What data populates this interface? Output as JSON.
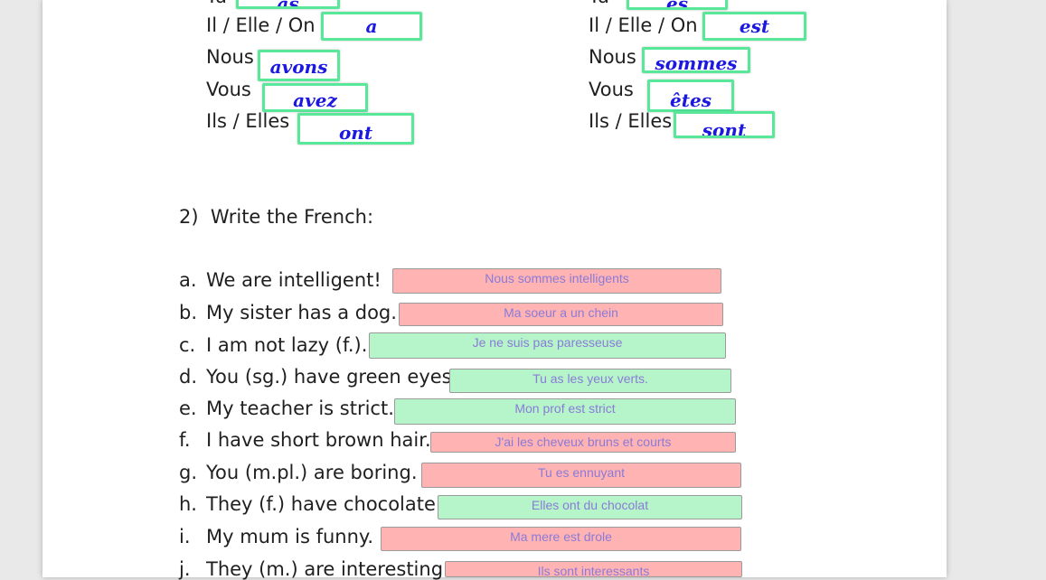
{
  "section1": {
    "left": [
      {
        "pronoun": "Tu",
        "answer": "as"
      },
      {
        "pronoun": "Il / Elle / On",
        "answer": "a"
      },
      {
        "pronoun": "Nous",
        "answer": "avons"
      },
      {
        "pronoun": "Vous",
        "answer": "avez"
      },
      {
        "pronoun": "Ils / Elles",
        "answer": "ont"
      }
    ],
    "right": [
      {
        "pronoun": "Tu",
        "answer": "es"
      },
      {
        "pronoun": "Il / Elle / On",
        "answer": "est"
      },
      {
        "pronoun": "Nous",
        "answer": "sommes"
      },
      {
        "pronoun": "Vous",
        "answer": "êtes"
      },
      {
        "pronoun": "Ils / Elles",
        "answer": "sont"
      }
    ]
  },
  "section2": {
    "heading": "2)  Write the French:",
    "items": [
      {
        "letter": "a.",
        "prompt": "We are intelligent!",
        "answer": "Nous sommes intelligents",
        "status": "wrong"
      },
      {
        "letter": "b.",
        "prompt": "My sister has a dog.",
        "answer": "Ma soeur a un chein",
        "status": "wrong"
      },
      {
        "letter": "c.",
        "prompt": "I am not lazy (f.).",
        "answer": "Je ne suis pas paresseuse",
        "status": "right"
      },
      {
        "letter": "d.",
        "prompt": "You (sg.) have green eyes.",
        "answer": "Tu as les yeux verts.",
        "status": "right"
      },
      {
        "letter": "e.",
        "prompt": "My teacher is strict.",
        "answer": "Mon prof est strict",
        "status": "right"
      },
      {
        "letter": "f.",
        "prompt": "I have short brown hair.",
        "answer": "J'ai les cheveux bruns et courts",
        "status": "wrong"
      },
      {
        "letter": "g.",
        "prompt": "You (m.pl.) are boring.",
        "answer": "Tu es ennuyant",
        "status": "wrong"
      },
      {
        "letter": "h.",
        "prompt": "They (f.) have chocolate.",
        "answer": "Elles ont du chocolat",
        "status": "right"
      },
      {
        "letter": "i.",
        "prompt": "My mum is funny.",
        "answer": "Ma mere est drole",
        "status": "wrong"
      },
      {
        "letter": "j.",
        "prompt": "They (m.) are interesting.",
        "answer": "Ils sont interessants",
        "status": "wrong"
      }
    ]
  },
  "colors": {
    "correct": "#b5f5c9",
    "incorrect": "#ffb3b3",
    "conjugation_border": "#59e79a",
    "conjugation_text": "#1b18e0",
    "answer_text": "#8a7bd8"
  }
}
